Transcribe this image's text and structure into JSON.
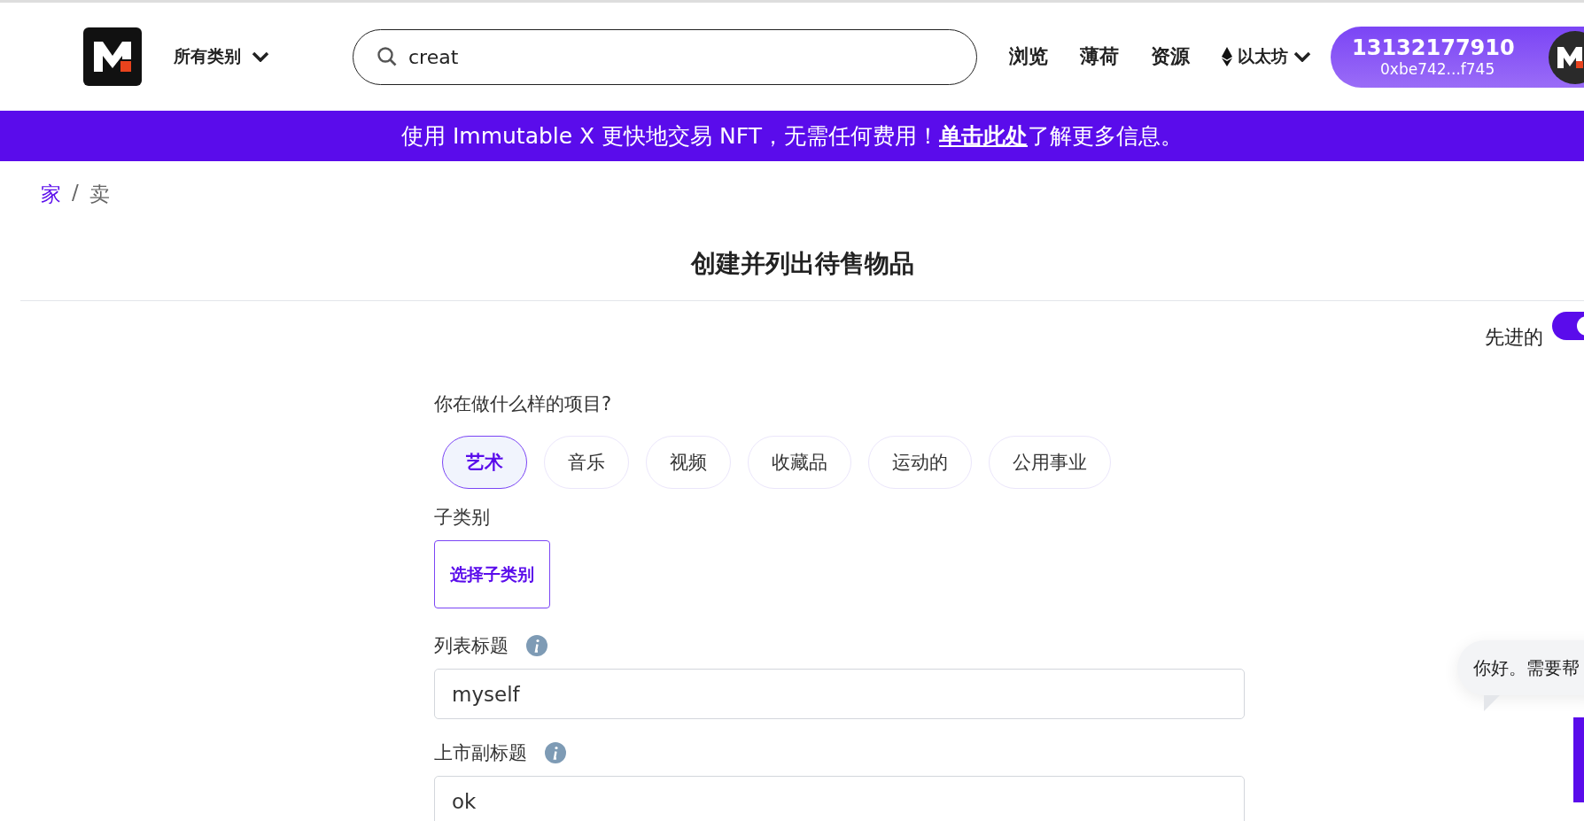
{
  "header": {
    "category_menu": "所有类别",
    "search": {
      "value": "creat"
    },
    "nav": [
      "浏览",
      "薄荷",
      "资源"
    ],
    "network": "以太坊",
    "account": {
      "phone": "13132177910",
      "address": "0xbe742...f745"
    }
  },
  "banner": {
    "before": "使用 Immutable X 更快地交易 NFT，无需任何费用！",
    "link": "单击此处",
    "after": "了解更多信息。"
  },
  "breadcrumb": [
    {
      "label": "家",
      "kind": "link"
    },
    {
      "label": "卖",
      "kind": "current"
    }
  ],
  "breadcrumb_separator": "/",
  "page_title": "创建并列出待售物品",
  "advanced_toggle": {
    "label": "先进的",
    "on": true
  },
  "form": {
    "type_question": "你在做什么样的项目?",
    "types": [
      {
        "label": "艺术",
        "selected": true
      },
      {
        "label": "音乐",
        "selected": false
      },
      {
        "label": "视频",
        "selected": false
      },
      {
        "label": "收藏品",
        "selected": false
      },
      {
        "label": "运动的",
        "selected": false
      },
      {
        "label": "公用事业",
        "selected": false
      }
    ],
    "subcategory_label": "子类别",
    "subcategory_button": "选择子类别",
    "fields": [
      {
        "label": "列表标题",
        "value": "myself"
      },
      {
        "label": "上市副标题",
        "value": "ok"
      }
    ]
  },
  "chat_bubble": "你好。需要帮"
}
